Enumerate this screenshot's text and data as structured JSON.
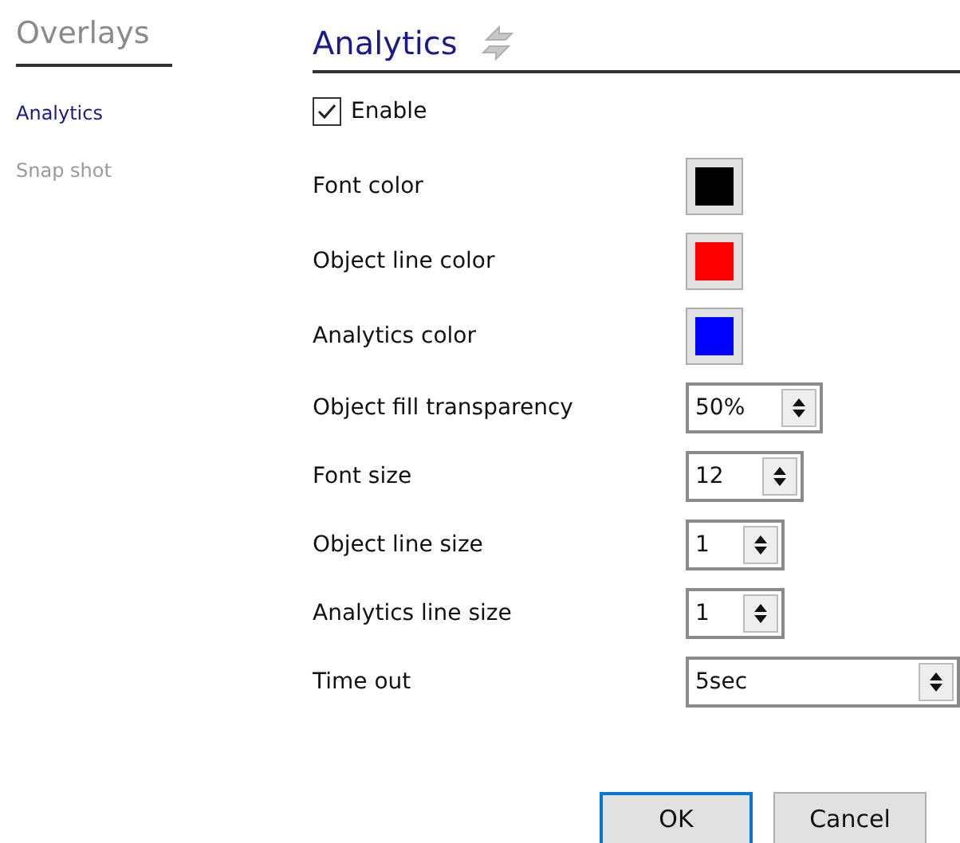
{
  "sidebar": {
    "title": "Overlays",
    "items": [
      {
        "label": "Analytics",
        "selected": true
      },
      {
        "label": "Snap shot",
        "selected": false
      }
    ]
  },
  "panel": {
    "title": "Analytics",
    "enable": {
      "label": "Enable",
      "checked": true
    },
    "rows": [
      {
        "kind": "color",
        "label": "Font color",
        "color": "#000000"
      },
      {
        "kind": "color",
        "label": "Object line color",
        "color": "#ff0000"
      },
      {
        "kind": "color",
        "label": "Analytics color",
        "color": "#0000ff"
      },
      {
        "kind": "spin",
        "label": "Object fill transparency",
        "value": "50%"
      },
      {
        "kind": "spin",
        "label": "Font size",
        "value": "12"
      },
      {
        "kind": "spin",
        "label": "Object line size",
        "value": "1"
      },
      {
        "kind": "spin",
        "label": "Analytics line size",
        "value": "1"
      },
      {
        "kind": "wide",
        "label": "Time out",
        "value": "5sec"
      }
    ]
  },
  "buttons": [
    {
      "label": "OK",
      "default": true
    },
    {
      "label": "Cancel",
      "default": false
    }
  ]
}
